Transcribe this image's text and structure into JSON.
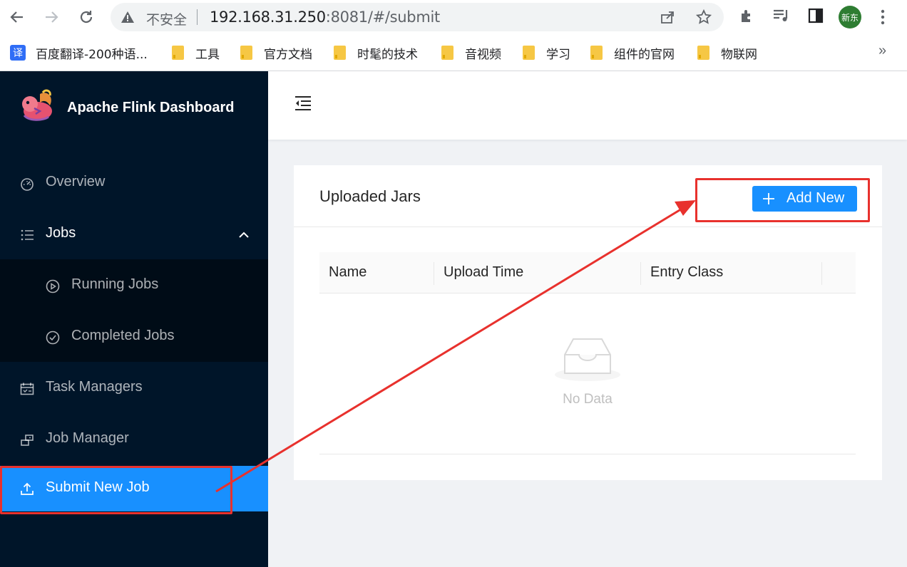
{
  "browser": {
    "insecure_label": "不安全",
    "url_host": "192.168.31.250",
    "url_rest": ":8081/#/submit",
    "avatar_text": "新东",
    "bookmarks": [
      {
        "label": "百度翻译-200种语...",
        "icon": "translate-icon"
      },
      {
        "label": "工具",
        "icon": "folder-icon"
      },
      {
        "label": "官方文档",
        "icon": "folder-icon"
      },
      {
        "label": "时髦的技术",
        "icon": "folder-icon"
      },
      {
        "label": "音视频",
        "icon": "folder-icon"
      },
      {
        "label": "学习",
        "icon": "folder-icon"
      },
      {
        "label": "组件的官网",
        "icon": "folder-icon"
      },
      {
        "label": "物联网",
        "icon": "folder-icon"
      }
    ],
    "translate_glyph": "译",
    "more_glyph": "»"
  },
  "sidebar": {
    "title": "Apache Flink Dashboard",
    "items": [
      {
        "label": "Overview",
        "icon": "dashboard-icon"
      },
      {
        "label": "Jobs",
        "icon": "list-icon",
        "expanded": true
      },
      {
        "label": "Running Jobs",
        "icon": "play-circle-icon"
      },
      {
        "label": "Completed Jobs",
        "icon": "check-circle-icon"
      },
      {
        "label": "Task Managers",
        "icon": "schedule-icon"
      },
      {
        "label": "Job Manager",
        "icon": "cluster-icon"
      },
      {
        "label": "Submit New Job",
        "icon": "upload-icon",
        "active": true
      }
    ]
  },
  "main": {
    "card_title": "Uploaded Jars",
    "add_button": "Add New",
    "columns": [
      "Name",
      "Upload Time",
      "Entry Class"
    ],
    "empty_text": "No Data"
  },
  "colors": {
    "sidebar_bg": "#001529",
    "active": "#1890ff",
    "annotation": "#e8312d"
  }
}
